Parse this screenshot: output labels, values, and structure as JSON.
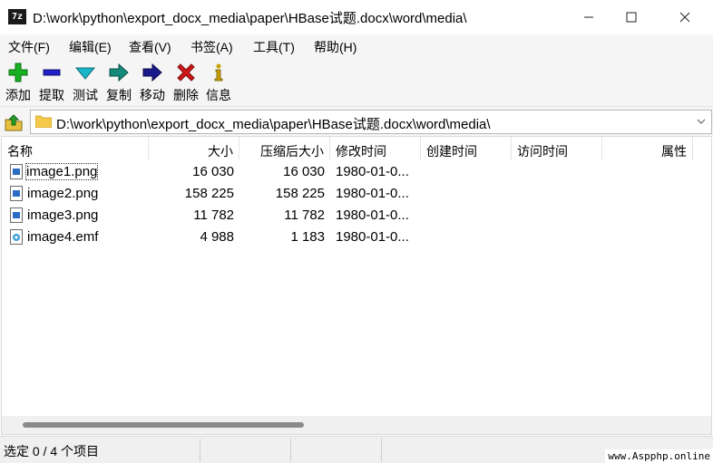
{
  "window": {
    "app_icon_text": "7z",
    "title": "D:\\work\\python\\export_docx_media\\paper\\HBase试题.docx\\word\\media\\",
    "minimize": "—",
    "maximize": "☐",
    "close": "✕"
  },
  "menu": {
    "items": [
      {
        "label": "文件(F)"
      },
      {
        "label": "编辑(E)"
      },
      {
        "label": "查看(V)"
      },
      {
        "label": "书签(A)"
      },
      {
        "label": "工具(T)"
      },
      {
        "label": "帮助(H)"
      }
    ]
  },
  "toolbar": {
    "items": [
      {
        "label": "添加",
        "icon": "plus-icon",
        "color": "#17b221"
      },
      {
        "label": "提取",
        "icon": "minus-icon",
        "color": "#2020c8"
      },
      {
        "label": "测试",
        "icon": "check-icon",
        "color": "#19b5c8"
      },
      {
        "label": "复制",
        "icon": "copy-arrow-icon",
        "color": "#148a7a"
      },
      {
        "label": "移动",
        "icon": "move-arrow-icon",
        "color": "#1a1a8c"
      },
      {
        "label": "删除",
        "icon": "delete-x-icon",
        "color": "#d01818"
      },
      {
        "label": "信息",
        "icon": "info-icon",
        "color": "#c8a000"
      }
    ]
  },
  "address": {
    "path": "D:\\work\\python\\export_docx_media\\paper\\HBase试题.docx\\word\\media\\"
  },
  "columns": {
    "name": "名称",
    "size": "大小",
    "packed": "压缩后大小",
    "modified": "修改时间",
    "created": "创建时间",
    "accessed": "访问时间",
    "attributes": "属性"
  },
  "files": [
    {
      "name": "image1.png",
      "size": "16 030",
      "packed": "16 030",
      "modified": "1980-01-0...",
      "type": "png"
    },
    {
      "name": "image2.png",
      "size": "158 225",
      "packed": "158 225",
      "modified": "1980-01-0...",
      "type": "png"
    },
    {
      "name": "image3.png",
      "size": "11 782",
      "packed": "11 782",
      "modified": "1980-01-0...",
      "type": "png"
    },
    {
      "name": "image4.emf",
      "size": "4 988",
      "packed": "1 183",
      "modified": "1980-01-0...",
      "type": "emf"
    }
  ],
  "status": {
    "text": "选定 0 / 4 个项目",
    "watermark": "www.Aspphp.online"
  }
}
